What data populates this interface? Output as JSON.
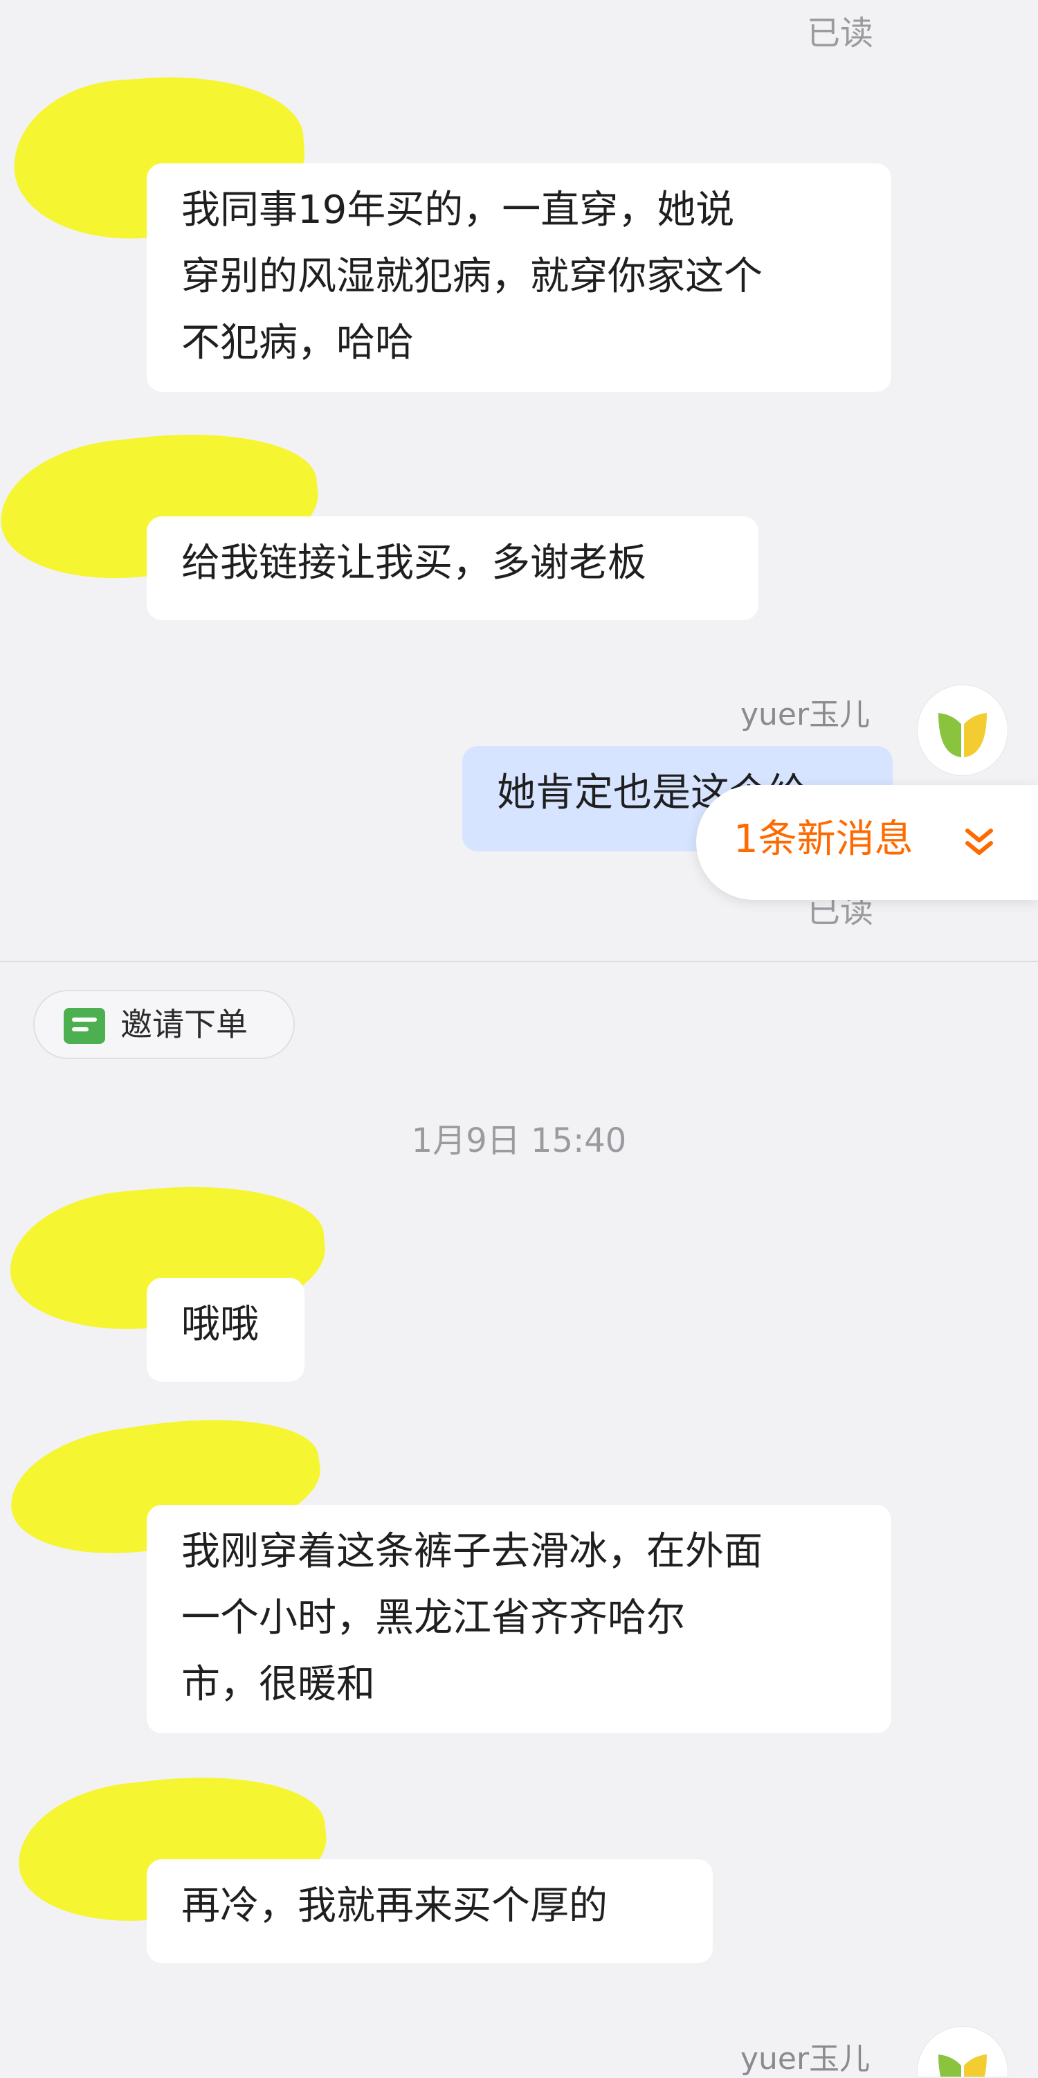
{
  "chat": {
    "read_status_top": "已读",
    "read_status_mid": "已读",
    "my_name": "yuer玉儿",
    "messages": [
      {
        "lines": [
          "我同事19年买的，一直穿，她说",
          "穿别的风湿就犯病，就穿你家这个",
          "不犯病，哈哈"
        ],
        "from": "customer"
      },
      {
        "lines": [
          "给我链接让我买，多谢老板"
        ],
        "from": "customer"
      },
      {
        "lines": [
          "她肯定也是这个给"
        ],
        "from": "me"
      },
      {
        "lines": [
          "哦哦"
        ],
        "from": "customer"
      },
      {
        "lines": [
          "我刚穿着这条裤子去滑冰，在外面",
          "一个小时，黑龙江省齐齐哈尔",
          "市，很暖和"
        ],
        "from": "customer"
      },
      {
        "lines": [
          "再冷，我就再来买个厚的"
        ],
        "from": "customer"
      }
    ],
    "new_message_banner": "1条新消息",
    "invite_order_label": "邀请下单",
    "timestamp": "1月9日 15:40"
  },
  "colors": {
    "background": "#f2f2f5",
    "bubble_customer": "#ffffff",
    "bubble_me": "#d6e4ff",
    "accent_orange": "#ff6a00",
    "avatar_green": "#8ac43f",
    "invite_icon_green": "#4caf50",
    "redaction_yellow": "#f6f52a"
  },
  "icons": {
    "avatar": "leaf-logo-icon",
    "new_message_arrow": "double-chevron-down-icon",
    "invite": "order-card-icon"
  }
}
